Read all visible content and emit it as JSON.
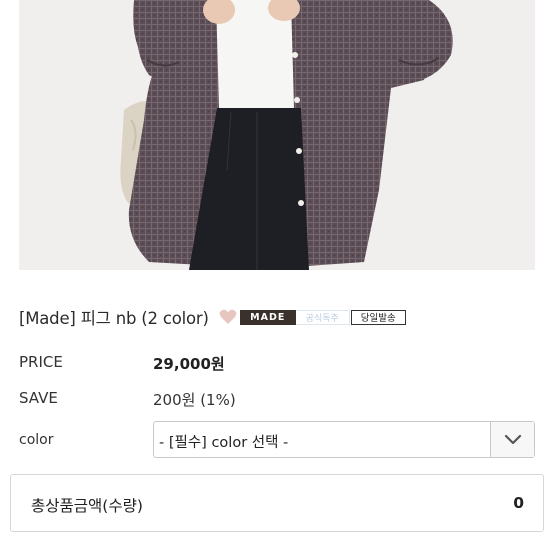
{
  "product": {
    "image_alt": "product-photo",
    "title": "[Made] 피그 nb (2 color)",
    "badges": {
      "made": "MADE",
      "custom": "공식독주",
      "same_day": "당일발송"
    }
  },
  "info": {
    "price_label": "PRICE",
    "price_value": "29,000원",
    "save_label": "SAVE",
    "save_value": "200원 (1%)",
    "color_label": "color"
  },
  "option": {
    "color_select_value": "- [필수] color 선택 -"
  },
  "total": {
    "label": "총상품금액(수량)",
    "value": "0"
  },
  "colors": {
    "shirt": "#5e5058",
    "tee": "#f6f6f4",
    "pants": "#1d1f24",
    "bag": "#d9d2c2",
    "background": "#f1efee",
    "made_badge": "#3a302c",
    "heart": "#e8c6c0"
  }
}
